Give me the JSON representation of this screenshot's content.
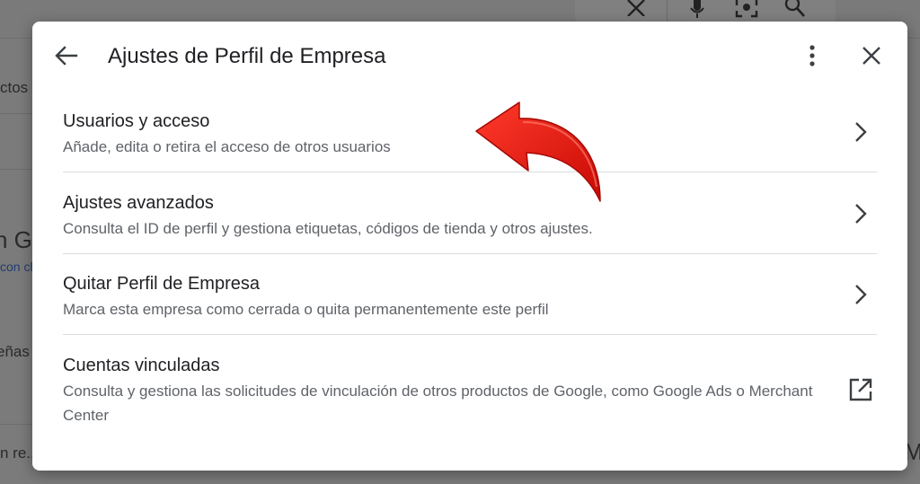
{
  "background": {
    "partial_texts": [
      "ctos",
      "n G",
      "con cl",
      "eñas",
      "n re...",
      "M"
    ]
  },
  "dialog": {
    "title": "Ajustes de Perfil de Empresa",
    "back_icon": "arrow-back-icon",
    "more_icon": "more-vert-icon",
    "close_icon": "close-icon",
    "items": [
      {
        "title": "Usuarios y acceso",
        "description": "Añade, edita o retira el acceso de otros usuarios",
        "trailing_icon": "chevron-right-icon"
      },
      {
        "title": "Ajustes avanzados",
        "description": "Consulta el ID de perfil y gestiona etiquetas, códigos de tienda y otros ajustes.",
        "trailing_icon": "chevron-right-icon"
      },
      {
        "title": "Quitar Perfil de Empresa",
        "description": "Marca esta empresa como cerrada o quita permanentemente este perfil",
        "trailing_icon": "chevron-right-icon"
      },
      {
        "title": "Cuentas vinculadas",
        "description": "Consulta y gestiona las solicitudes de vinculación de otros productos de Google, como Google Ads o Merchant Center",
        "trailing_icon": "open-in-new-icon"
      }
    ]
  },
  "annotation": {
    "arrow_color": "#e3140c"
  },
  "colors": {
    "title_text": "#202124",
    "secondary_text": "#5f6368",
    "divider": "#dadce0",
    "overlay": "#7b7b7b"
  }
}
